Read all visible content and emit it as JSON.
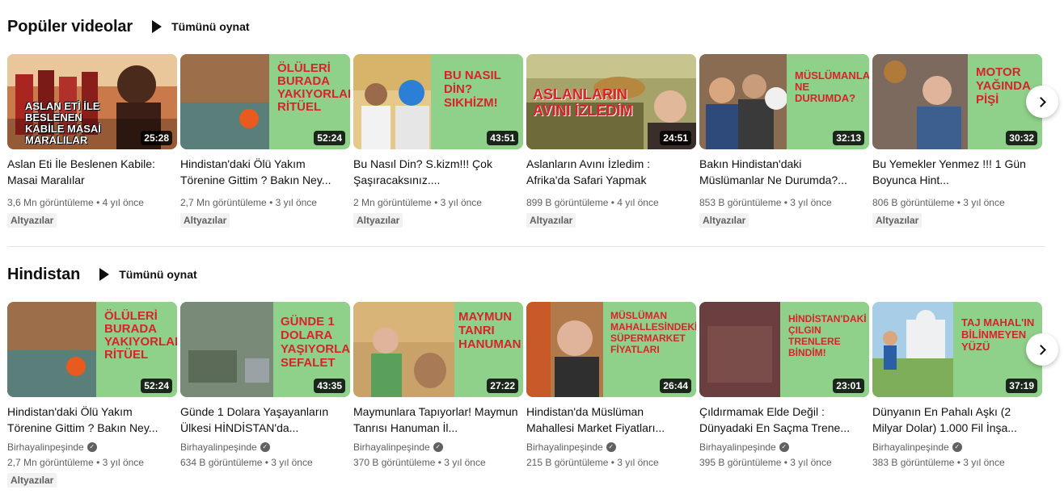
{
  "sections": [
    {
      "title": "Popüler videolar",
      "play_all": "Tümünü oynat",
      "videos": [
        {
          "title": "Aslan Eti İle Beslenen Kabile: Masai Maralılar",
          "views": "3,6 Mn görüntüleme",
          "age": "4 yıl önce",
          "duration": "25:28",
          "badge": "Altyazılar",
          "thumb_text": "ASLAN ETİ İLE BESLENEN KABİLE MASAİ MARALILAR"
        },
        {
          "title": "Hindistan'daki Ölü Yakım Törenine Gittim ? Bakın Ney...",
          "views": "2,7 Mn görüntüleme",
          "age": "3 yıl önce",
          "duration": "52:24",
          "badge": "Altyazılar",
          "thumb_text": "ÖLÜLERİ BURADA YAKIYORLAR RİTÜEL"
        },
        {
          "title": "Bu Nasıl Din? S.kizm!!! Çok Şaşıracaksınız....",
          "views": "2 Mn görüntüleme",
          "age": "3 yıl önce",
          "duration": "43:51",
          "badge": "Altyazılar",
          "thumb_text": "BU NASIL DİN? SIKHİZM!"
        },
        {
          "title": "Aslanların Avını İzledim : Afrika'da Safari Yapmak",
          "views": "899 B görüntüleme",
          "age": "4 yıl önce",
          "duration": "24:51",
          "badge": "Altyazılar",
          "thumb_text": "ASLANLARIN AVINI İZLEDİM"
        },
        {
          "title": "Bakın Hindistan'daki Müslümanlar Ne Durumda?...",
          "views": "853 B görüntüleme",
          "age": "3 yıl önce",
          "duration": "32:13",
          "badge": "Altyazılar",
          "thumb_text": "MÜSLÜMANLAR NE DURUMDA?"
        },
        {
          "title": "Bu Yemekler Yenmez !!! 1 Gün Boyunca Hint...",
          "views": "806 B görüntüleme",
          "age": "3 yıl önce",
          "duration": "30:32",
          "badge": "Altyazılar",
          "thumb_text": "MOTOR YAĞINDA PİŞİ"
        }
      ]
    },
    {
      "title": "Hindistan",
      "play_all": "Tümünü oynat",
      "videos": [
        {
          "title": "Hindistan'daki Ölü Yakım Törenine Gittim ? Bakın Ney...",
          "channel": "Birhayalinpeşinde",
          "views": "2,7 Mn görüntüleme",
          "age": "3 yıl önce",
          "duration": "52:24",
          "badge": "Altyazılar",
          "thumb_text": "ÖLÜLERİ BURADA YAKIYORLAR RİTÜEL"
        },
        {
          "title": "Günde 1 Dolara Yaşayanların Ülkesi HİNDİSTAN'da...",
          "channel": "Birhayalinpeşinde",
          "views": "634 B görüntüleme",
          "age": "3 yıl önce",
          "duration": "43:35",
          "badge": "",
          "thumb_text": "GÜNDE 1 DOLARA YAŞIYORLAR SEFALET"
        },
        {
          "title": "Maymunlara Tapıyorlar! Maymun Tanrısı Hanuman İl...",
          "channel": "Birhayalinpeşinde",
          "views": "370 B görüntüleme",
          "age": "3 yıl önce",
          "duration": "27:22",
          "badge": "",
          "thumb_text": "MAYMUN TANRI HANUMAN"
        },
        {
          "title": "Hindistan'da Müslüman Mahallesi Market Fiyatları...",
          "channel": "Birhayalinpeşinde",
          "views": "215 B görüntüleme",
          "age": "3 yıl önce",
          "duration": "26:44",
          "badge": "",
          "thumb_text": "MÜSLÜMAN MAHALLESİNDEKİ SÜPERMARKET FİYATLARI"
        },
        {
          "title": "Çıldırmamak Elde Değil : Dünyadaki En Saçma Trene...",
          "channel": "Birhayalinpeşinde",
          "views": "395 B görüntüleme",
          "age": "3 yıl önce",
          "duration": "23:01",
          "badge": "",
          "thumb_text": "HİNDİSTAN'DAKİ ÇILGIN TRENLERE BİNDİM!"
        },
        {
          "title": "Dünyanın En Pahalı Aşkı (2 Milyar Dolar) 1.000 Fil İnşa...",
          "channel": "Birhayalinpeşinde",
          "views": "383 B görüntüleme",
          "age": "3 yıl önce",
          "duration": "37:19",
          "badge": "",
          "thumb_text": "TAJ MAHAL'IN BİLİNMEYEN YÜZÜ"
        }
      ]
    }
  ],
  "colors": {
    "thumb_green": "#8fd18a",
    "thumb_red": "#d9232b"
  }
}
